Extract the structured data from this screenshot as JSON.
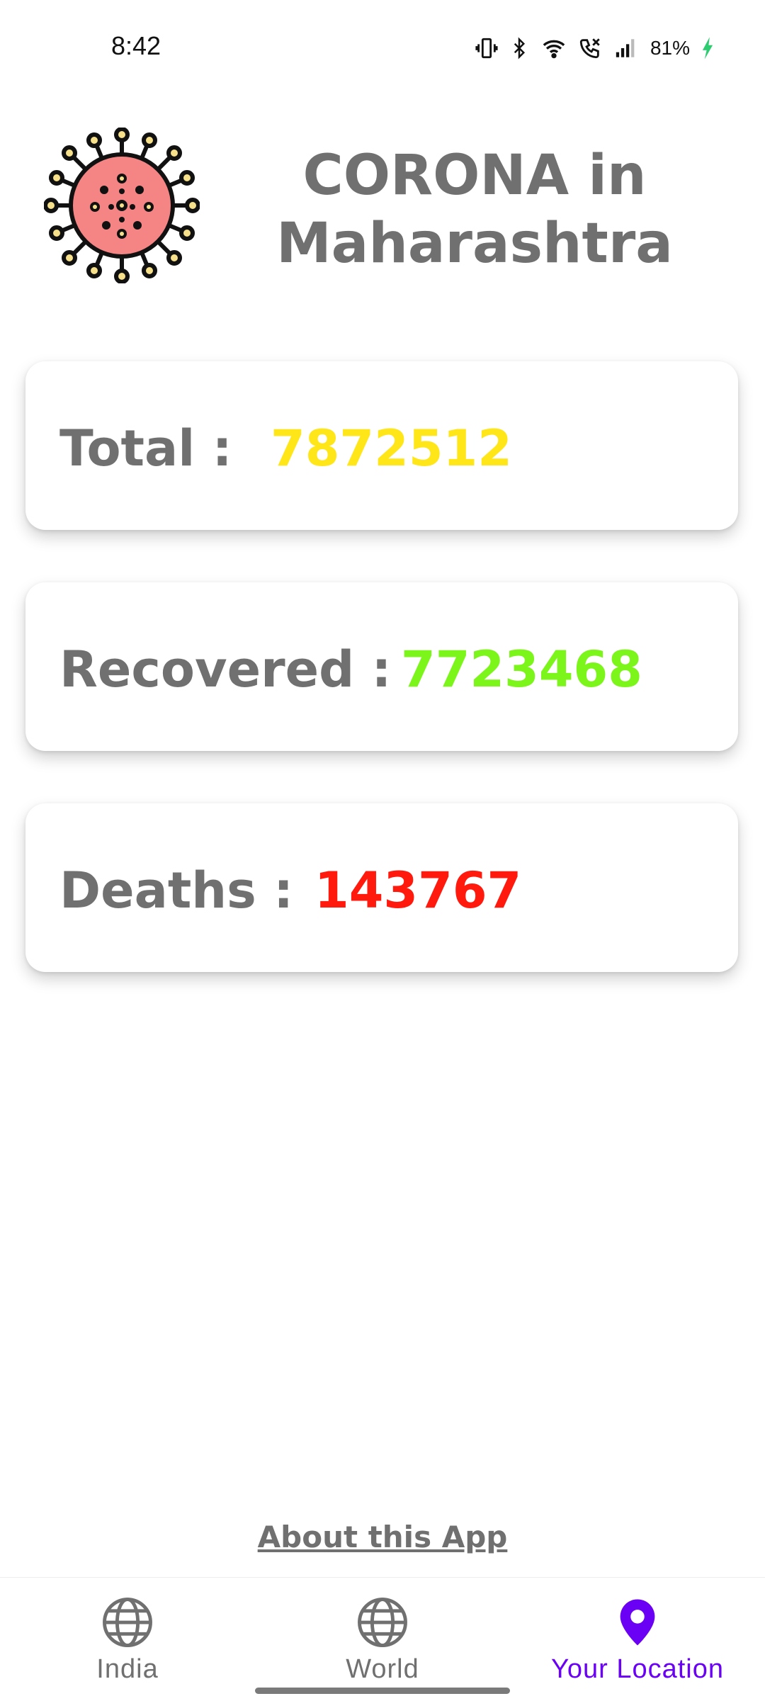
{
  "status_bar": {
    "time": "8:42",
    "battery": "81%",
    "icons": [
      "vibrate-icon",
      "bluetooth-icon",
      "wifi-icon",
      "call-icon",
      "signal-icon",
      "battery-charging-icon"
    ]
  },
  "header": {
    "title_line1": "CORONA in",
    "title_line2": "Maharashtra",
    "logo_icon": "virus-icon"
  },
  "stats": {
    "total": {
      "label": "Total :",
      "value": "7872512",
      "color": "#FFE619"
    },
    "recovered": {
      "label": "Recovered :",
      "value": "7723468",
      "color": "#7CF51A"
    },
    "deaths": {
      "label": "Deaths :",
      "value": "143767",
      "color": "#FF1A0D"
    }
  },
  "about_link": "About this App",
  "bottom_nav": {
    "items": [
      {
        "label": "India",
        "icon": "globe-icon",
        "active": false
      },
      {
        "label": "World",
        "icon": "globe-icon",
        "active": false
      },
      {
        "label": "Your Location",
        "icon": "location-pin-icon",
        "active": true
      }
    ],
    "active_color": "#6A00F4",
    "inactive_color": "#707070"
  }
}
